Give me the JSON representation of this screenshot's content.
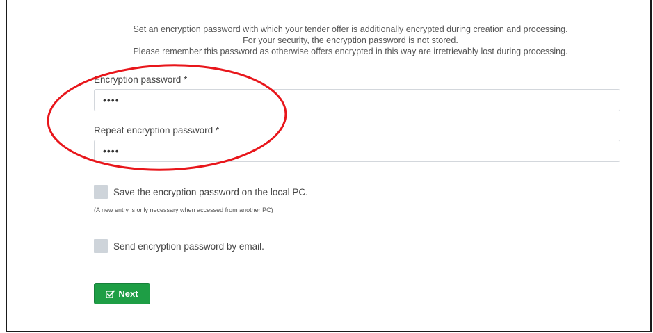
{
  "intro": {
    "line1": "Set an encryption password with which your tender offer is additionally encrypted during creation and processing.",
    "line2": "For your security, the encryption password is not stored.",
    "line3": "Please remember this password as otherwise offers encrypted in this way are irretrievably lost during processing."
  },
  "password": {
    "label": "Encryption password *",
    "value": "••••"
  },
  "repeat_password": {
    "label": "Repeat encryption password *",
    "value": "••••"
  },
  "save_local": {
    "label": "Save the encryption password on the local PC.",
    "checked": false,
    "hint": "(A new entry is only necessary when accessed from another PC)"
  },
  "send_email": {
    "label": "Send encryption password by email.",
    "checked": false
  },
  "next_button": {
    "label": "Next",
    "icon": "check-square-icon",
    "color": "#1e9e45"
  },
  "annotation": {
    "color": "#e8161b"
  }
}
